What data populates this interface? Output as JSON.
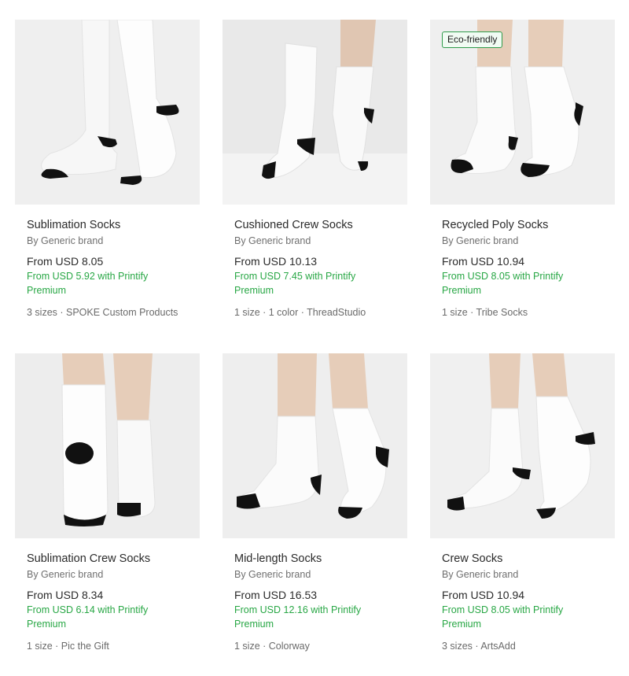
{
  "products": [
    {
      "title": "Sublimation Socks",
      "brand": "By Generic brand",
      "price": "From USD 8.05",
      "premium_price": "From USD 5.92 with Printify Premium",
      "meta": "3 sizes · SPOKE Custom Products",
      "badge": ""
    },
    {
      "title": "Cushioned Crew Socks",
      "brand": "By Generic brand",
      "price": "From USD 10.13",
      "premium_price": "From USD 7.45 with Printify Premium",
      "meta": "1 size · 1 color · ThreadStudio",
      "badge": ""
    },
    {
      "title": "Recycled Poly Socks",
      "brand": "By Generic brand",
      "price": "From USD 10.94",
      "premium_price": "From USD 8.05 with Printify Premium",
      "meta": "1 size · Tribe Socks",
      "badge": "Eco-friendly"
    },
    {
      "title": "Sublimation Crew Socks",
      "brand": "By Generic brand",
      "price": "From USD 8.34",
      "premium_price": "From USD 6.14 with Printify Premium",
      "meta": "1 size · Pic the Gift",
      "badge": ""
    },
    {
      "title": "Mid-length Socks",
      "brand": "By Generic brand",
      "price": "From USD 16.53",
      "premium_price": "From USD 12.16 with Printify Premium",
      "meta": "1 size · Colorway",
      "badge": ""
    },
    {
      "title": "Crew Socks",
      "brand": "By Generic brand",
      "price": "From USD 10.94",
      "premium_price": "From USD 8.05 with Printify Premium",
      "meta": "3 sizes · ArtsAdd",
      "badge": ""
    }
  ],
  "colors": {
    "premium_green": "#28a745",
    "badge_border": "#2e9a4a",
    "image_bg": "#ececec"
  }
}
